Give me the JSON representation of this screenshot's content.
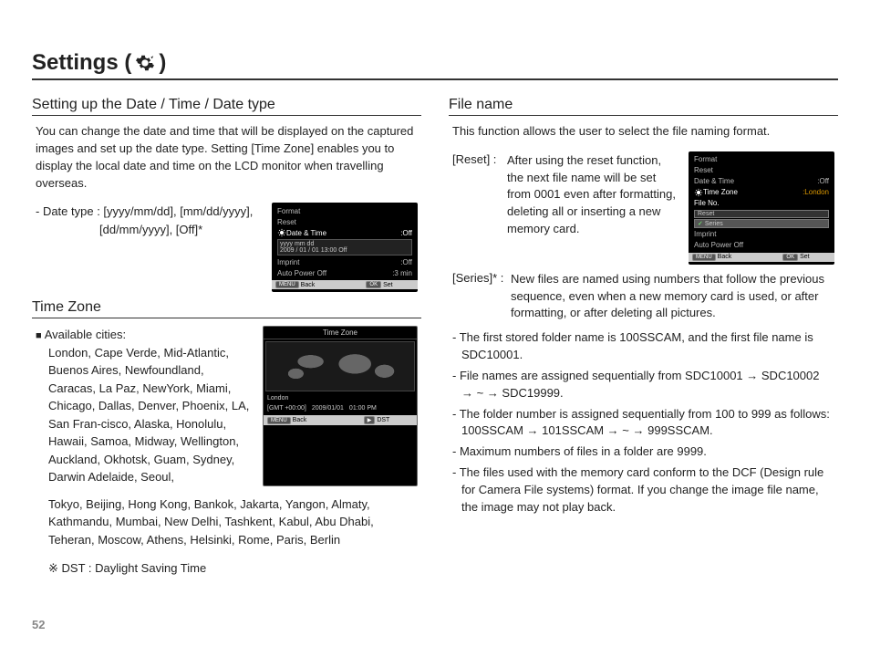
{
  "page": {
    "title_a": "Settings (",
    "title_b": ")",
    "number": "52"
  },
  "left": {
    "heading1": "Setting up the Date / Time / Date type",
    "intro": "You can change the date and time that will be displayed on the captured images and set up the date type. Setting [Time Zone] enables you to display the local date and time on the LCD monitor when travelling overseas.",
    "date_type_line1": "- Date type : [yyyy/mm/dd], [mm/dd/yyyy],",
    "date_type_line2": "[dd/mm/yyyy], [Off]*",
    "lcd1": {
      "r1": "Format",
      "r2": "Reset",
      "r3l": "Date & Time",
      "r3r": ":Off",
      "box": "yyyy mm dd",
      "boxline": "2009 / 01 / 01   13:00   Off",
      "r5l": "Imprint",
      "r5r": ":Off",
      "r6l": "Auto Power Off",
      "r6r": ":3 min",
      "fbackbadge": "MENU",
      "fback": "Back",
      "fsetbadge": "OK",
      "fset": "Set"
    },
    "heading2": "Time Zone",
    "tz_label": "Available cities:",
    "tz_cities1": "London, Cape Verde, Mid-Atlantic, Buenos Aires, Newfoundland, Caracas, La Paz, NewYork, Miami, Chicago, Dallas, Denver, Phoenix, LA, San Fran-cisco, Alaska, Honolulu, Hawaii, Samoa, Midway, Wellington, Auckland, Okhotsk, Guam, Sydney, Darwin Adelaide, Seoul,",
    "tz_cities2": "Tokyo, Beijing, Hong Kong, Bankok, Jakarta, Yangon, Almaty, Kathmandu, Mumbai, New Delhi, Tashkent, Kabul, Abu Dhabi, Teheran, Moscow, Athens, Helsinki, Rome, Paris, Berlin",
    "lcd2": {
      "title": "Time Zone",
      "city": "London",
      "gmt": "[GMT +00:00]",
      "date": "2009/01/01",
      "time": "01:00 PM",
      "fbackbadge": "MENU",
      "fback": "Back",
      "fdstbadge": "▶",
      "fdst": "DST"
    },
    "dst_note": "※ DST : Daylight Saving Time"
  },
  "right": {
    "heading": "File name",
    "intro": "This function allows the user to select the file naming format.",
    "reset_label": "[Reset]  :",
    "reset_body": "After using the reset function, the next file name will be set from 0001 even after formatting, deleting all or inserting a new memory card.",
    "series_label": "[Series]* :",
    "series_body": "New files are named using numbers that follow the previous sequence, even when a new memory card is used, or after formatting, or after deleting all pictures.",
    "lcd": {
      "r1": "Format",
      "r2": "Reset",
      "r3l": "Date & Time",
      "r3r": ":Off",
      "r4l": "Time Zone",
      "r4r": ":London",
      "r5l": "File No.",
      "box1": "Reset",
      "box2": "Series",
      "r6l": "Imprint",
      "r7l": "Auto Power Off",
      "fbackbadge": "MENU",
      "fback": "Back",
      "fsetbadge": "OK",
      "fset": "Set"
    },
    "bullets": [
      "- The first stored folder name is 100SSCAM, and the first file name is SDC10001.",
      "- File names are assigned sequentially from SDC10001 → SDC10002 → ~ → SDC19999.",
      "- The folder number is assigned sequentially from 100 to 999 as follows: 100SSCAM → 101SSCAM → ~ → 999SSCAM.",
      "- Maximum numbers of files in a folder are 9999.",
      "- The files used with the memory card conform to the DCF (Design rule for Camera File systems) format. If you change the image file name, the image may not play back."
    ]
  }
}
